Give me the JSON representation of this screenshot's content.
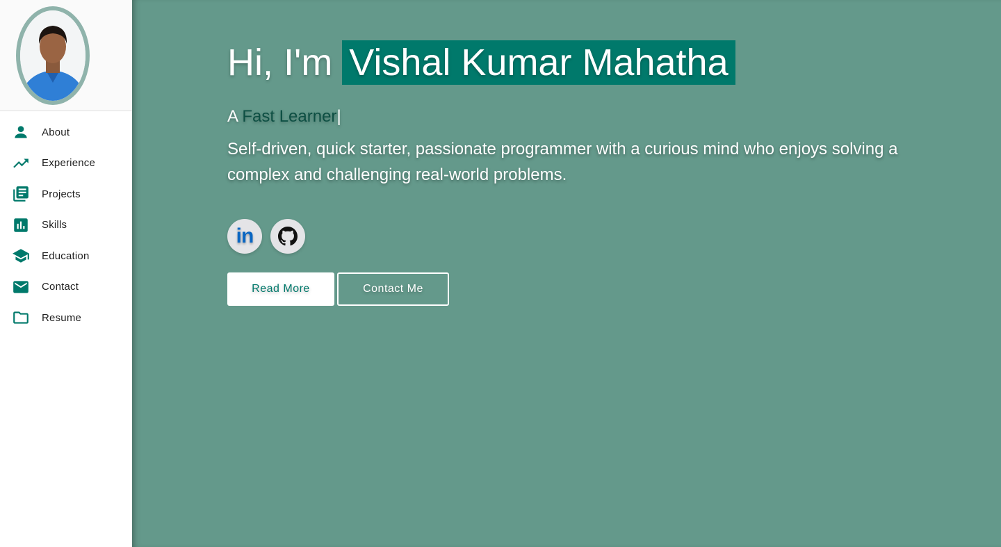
{
  "sidebar": {
    "profile_image_alt": "profile-photo",
    "items": [
      {
        "label": "About",
        "icon": "person-icon"
      },
      {
        "label": "Experience",
        "icon": "trending-up-icon"
      },
      {
        "label": "Projects",
        "icon": "library-books-icon"
      },
      {
        "label": "Skills",
        "icon": "bar-chart-icon"
      },
      {
        "label": "Education",
        "icon": "graduation-cap-icon"
      },
      {
        "label": "Contact",
        "icon": "mail-icon"
      },
      {
        "label": "Resume",
        "icon": "folder-icon"
      }
    ]
  },
  "hero": {
    "greeting": "Hi, I'm",
    "name": "Vishal Kumar Mahatha",
    "tagline_prefix": "A",
    "tagline_role": "Fast Learner",
    "tagline_cursor": "|",
    "bio": "Self-driven, quick starter, passionate programmer with a curious mind who enjoys solving a complex and challenging real-world problems.",
    "socials": [
      {
        "name": "LinkedIn",
        "glyph": "in"
      },
      {
        "name": "GitHub"
      }
    ],
    "read_more_label": "Read More",
    "contact_label": "Contact Me"
  },
  "colors": {
    "accent": "#00796b",
    "main_bg": "#64998b",
    "avatar_border": "#8fb3ab"
  }
}
